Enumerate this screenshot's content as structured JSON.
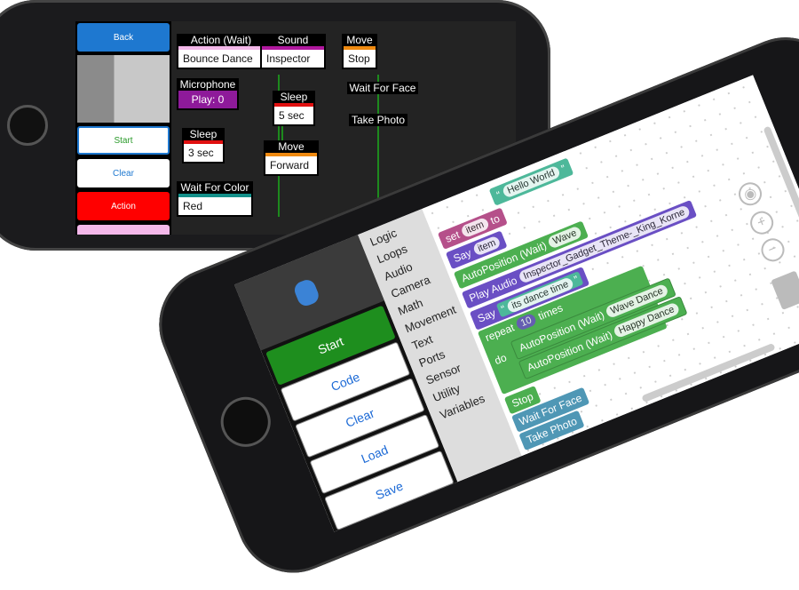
{
  "back_phone": {
    "sidebar": {
      "back": "Back",
      "start": "Start",
      "clear": "Clear",
      "action": "Action"
    },
    "blocks": [
      {
        "title": "Action (Wait)",
        "value": "Bounce Dance",
        "color": "#f4b8ea"
      },
      {
        "title": "Microphone",
        "value": "Play: 0",
        "color": "#8e1a9a"
      },
      {
        "title": "Sleep",
        "value": "3 sec",
        "color": "#e01010"
      },
      {
        "title": "Wait For Color",
        "value": "Red",
        "color": "#14908a"
      },
      {
        "title": "Sound",
        "value": "Inspector",
        "color": "#b0179e"
      },
      {
        "title": "Sleep",
        "value": "5 sec",
        "color": "#e01010"
      },
      {
        "title": "Move",
        "value": "Forward",
        "color": "#f08a10"
      },
      {
        "title": "Move",
        "value": "Stop",
        "color": "#f08a10"
      },
      {
        "title": "Wait For Face"
      },
      {
        "title": "Take Photo"
      }
    ]
  },
  "front_phone": {
    "sidebar": {
      "start": "Start",
      "code": "Code",
      "clear": "Clear",
      "load": "Load",
      "save": "Save"
    },
    "categories": [
      "Logic",
      "Loops",
      "Audio",
      "Camera",
      "Math",
      "Movement",
      "Text",
      "Ports",
      "Sensor",
      "Utility",
      "Variables"
    ],
    "blocks": {
      "hello": "Hello World",
      "set": "set",
      "item": "item",
      "to": "to",
      "say": "Say",
      "autoposition_wait": "AutoPosition (Wait)",
      "wave": "Wave",
      "play_audio": "Play Audio",
      "audio_file": "Inspector_Gadget_Theme-_King_Korne",
      "dance_text": "its dance time",
      "repeat": "repeat",
      "count": "10",
      "times": "times",
      "do": "do",
      "wave_dance": "Wave Dance",
      "happy_dance": "Happy Dance",
      "stop": "Stop",
      "wait_face": "Wait For Face",
      "take_photo": "Take Photo"
    },
    "colors": {
      "variable": "#b5508a",
      "say": "#6a4fc4",
      "movement": "#4caf50",
      "text": "#4db89a",
      "sensor": "#4f97b5"
    }
  }
}
